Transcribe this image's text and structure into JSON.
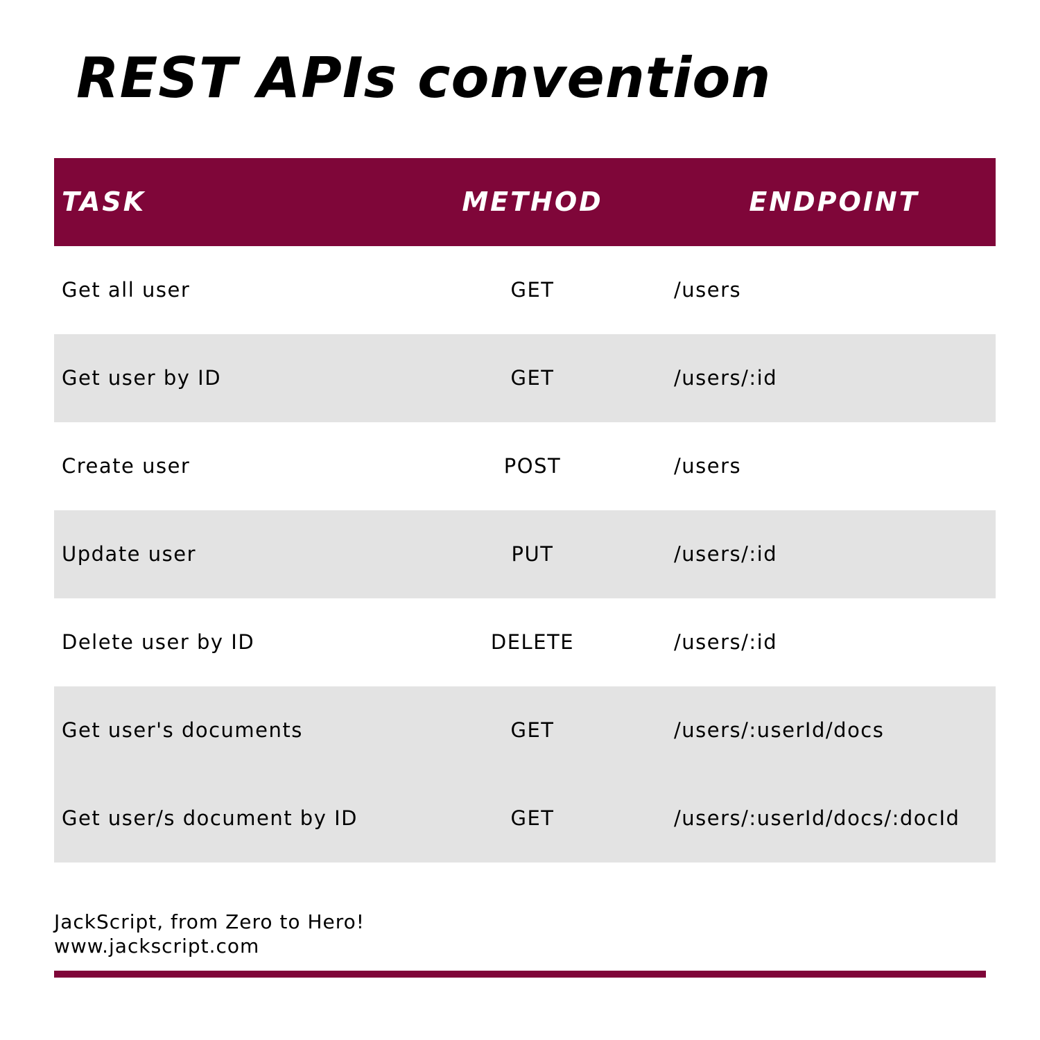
{
  "title": "REST APIs convention",
  "colors": {
    "accent": "#7f0639",
    "row_alt": "#e3e3e3",
    "row_plain": "#ffffff",
    "header_text": "#ffffff"
  },
  "table": {
    "headers": {
      "task": "TASK",
      "method": "METHOD",
      "endpoint": "ENDPOINT"
    },
    "rows": [
      {
        "task": "Get all user",
        "method": "GET",
        "endpoint": "/users",
        "shaded": false
      },
      {
        "task": "Get user by ID",
        "method": "GET",
        "endpoint": "/users/:id",
        "shaded": true
      },
      {
        "task": "Create user",
        "method": "POST",
        "endpoint": "/users",
        "shaded": false
      },
      {
        "task": "Update user",
        "method": "PUT",
        "endpoint": "/users/:id",
        "shaded": true
      },
      {
        "task": "Delete user by ID",
        "method": "DELETE",
        "endpoint": "/users/:id",
        "shaded": false
      },
      {
        "task": "Get user's documents",
        "method": "GET",
        "endpoint": "/users/:userId/docs",
        "shaded": true
      },
      {
        "task": "Get user/s document by ID",
        "method": "GET",
        "endpoint": "/users/:userId/docs/:docId",
        "shaded": true
      }
    ]
  },
  "footer": {
    "tagline": "JackScript, from Zero to Hero!",
    "website": "www.jackscript.com"
  }
}
